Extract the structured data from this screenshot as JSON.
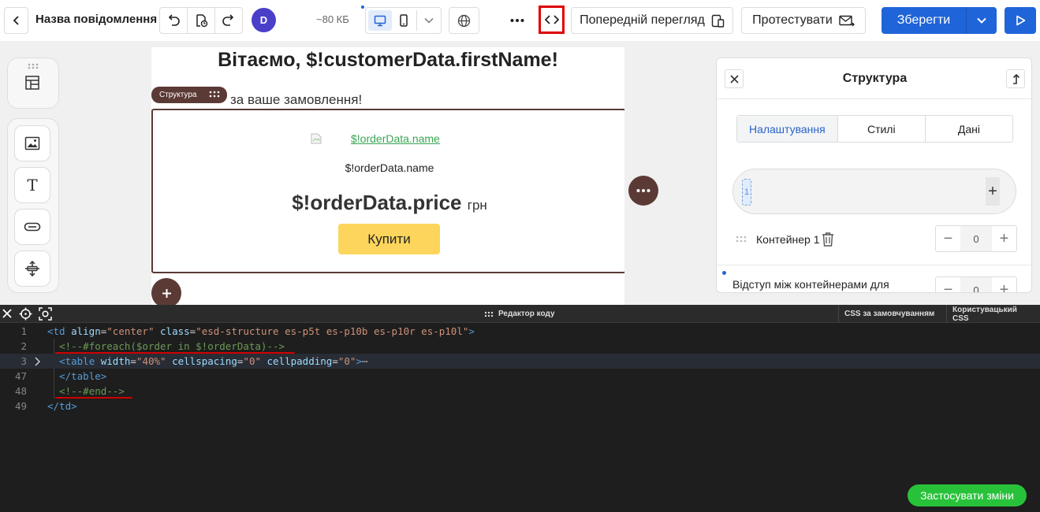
{
  "toolbar": {
    "title": "Назва повідомлення",
    "avatar": "D",
    "size": "~80 КБ",
    "preview_label": "Попередній перегляд",
    "test_label": "Протестувати",
    "save_label": "Зберегти"
  },
  "canvas": {
    "greeting": "Вітаємо, $!customerData.firstName!",
    "thanks": "за ваше замовлення!",
    "structure_tag": "Структура",
    "image_alt_link": "$!orderData.name",
    "product_name": "$!orderData.name",
    "price": "$!orderData.price",
    "currency": "грн",
    "buy_label": "Купити"
  },
  "right_panel": {
    "title": "Структура",
    "tabs": [
      "Налаштування",
      "Стилі",
      "Дані"
    ],
    "active_tab": "Налаштування",
    "chip_value": "1",
    "plus": "+",
    "container_label": "Контейнер 1",
    "container_value": "0",
    "spacing_label": "Відступ між контейнерами для",
    "spacing_value": "0",
    "minus": "−"
  },
  "editor": {
    "title": "Редактор коду",
    "tabs": [
      "CSS за замовчуванням",
      "Користувацький CSS"
    ],
    "lines": [
      {
        "num": "1",
        "parts": [
          [
            "tag",
            "<td "
          ],
          [
            "attr",
            "align"
          ],
          [
            "plain",
            "="
          ],
          [
            "str",
            "\"center\""
          ],
          [
            "plain",
            " "
          ],
          [
            "attr",
            "class"
          ],
          [
            "plain",
            "="
          ],
          [
            "str",
            "\"esd-structure es-p5t es-p10b es-p10r es-p10l\""
          ],
          [
            "tag",
            ">"
          ]
        ]
      },
      {
        "num": "2",
        "parts": [
          [
            "plain",
            "  "
          ],
          [
            "cmt",
            "<!--#foreach($order in $!orderData)-->"
          ]
        ]
      },
      {
        "num": "3",
        "parts": [
          [
            "plain",
            "  "
          ],
          [
            "tag",
            "<table "
          ],
          [
            "attr",
            "width"
          ],
          [
            "plain",
            "="
          ],
          [
            "str",
            "\"40%\""
          ],
          [
            "plain",
            " "
          ],
          [
            "attr",
            "cellspacing"
          ],
          [
            "plain",
            "="
          ],
          [
            "str",
            "\"0\""
          ],
          [
            "plain",
            " "
          ],
          [
            "attr",
            "cellpadding"
          ],
          [
            "plain",
            "="
          ],
          [
            "str",
            "\"0\""
          ],
          [
            "tag",
            ">"
          ],
          [
            "ell",
            "⋯"
          ]
        ]
      },
      {
        "num": "47",
        "parts": [
          [
            "plain",
            "  "
          ],
          [
            "tag",
            "</table>"
          ]
        ]
      },
      {
        "num": "48",
        "parts": [
          [
            "plain",
            "  "
          ],
          [
            "cmt",
            "<!--#end-->"
          ]
        ]
      },
      {
        "num": "49",
        "parts": [
          [
            "tag",
            "</td>"
          ]
        ]
      }
    ],
    "apply_label": "Застосувати зміни"
  },
  "colors": {
    "primary": "#1f64d8",
    "structure": "#5b3a36",
    "buy": "#fdd55c",
    "apply": "#28c23a",
    "highlight": "#e00000"
  }
}
